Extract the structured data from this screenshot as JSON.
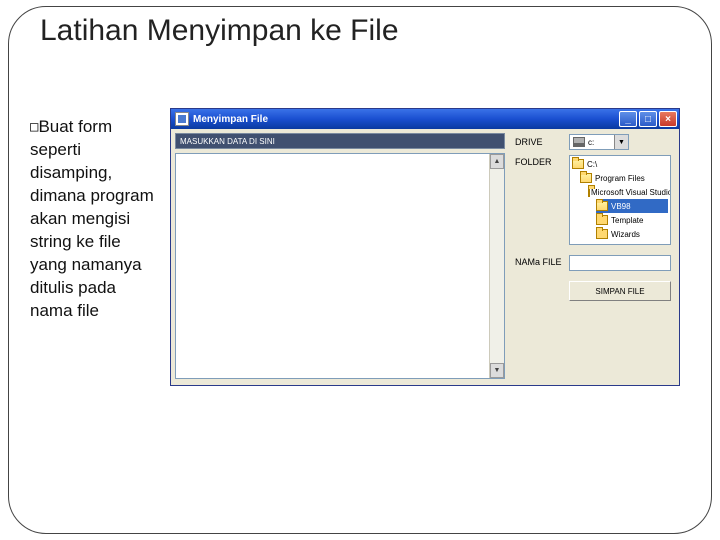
{
  "slide": {
    "title": "Latihan Menyimpan ke File",
    "bullet": "Buat form seperti disamping, dimana program akan mengisi string ke file yang namanya ditulis pada nama file"
  },
  "window": {
    "title": "Menyimpan File",
    "input_placeholder": "MASUKKAN DATA DI SINI",
    "labels": {
      "drive": "DRIVE",
      "folder": "FOLDER",
      "nama_file": "NAMa FILE"
    },
    "drive_selected": "c:",
    "folder_tree": [
      {
        "label": "C:\\",
        "indent": 0,
        "open": true,
        "selected": false
      },
      {
        "label": "Program Files",
        "indent": 1,
        "open": true,
        "selected": false
      },
      {
        "label": "Microsoft Visual Studio",
        "indent": 2,
        "open": true,
        "selected": false
      },
      {
        "label": "VB98",
        "indent": 3,
        "open": true,
        "selected": true
      },
      {
        "label": "Template",
        "indent": 3,
        "open": false,
        "selected": false
      },
      {
        "label": "Wizards",
        "indent": 3,
        "open": false,
        "selected": false
      }
    ],
    "button_save": "SIMPAN FILE"
  }
}
